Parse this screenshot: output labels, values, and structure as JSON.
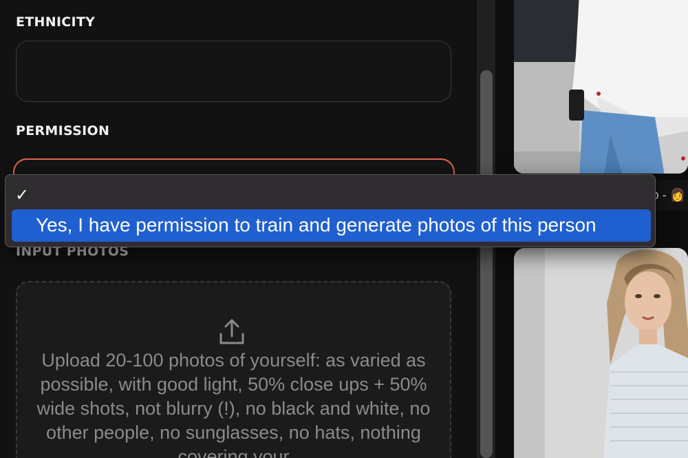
{
  "form": {
    "ethnicity_label": "ETHNICITY",
    "ethnicity_value": "",
    "permission_label": "PERMISSION",
    "input_photos_label": "INPUT PHOTOS",
    "upload_instructions": "Upload 20-100 photos of yourself: as varied as possible, with good light, 50% close ups + 50% wide shots, not blurry (!), no black and white, no other people, no sunglasses, no hats, nothing covering your"
  },
  "dropdown": {
    "options": [
      {
        "label": "",
        "checked": true
      },
      {
        "label": "Yes, I have permission to train and generate photos of this person",
        "highlighted": true
      }
    ],
    "checkmark": "✓"
  },
  "gallery": {
    "photos": [
      {
        "name": "photo-woman-white-sweater-jeans",
        "caption": "o - 👩"
      },
      {
        "name": "photo-woman-knit-sweater-portrait",
        "caption": ""
      }
    ]
  },
  "colors": {
    "accent_border": "#e06a52",
    "selection_blue": "#1f5fd0",
    "panel_bg": "#121212"
  },
  "icons": [
    "upload-icon",
    "checkmark-icon"
  ]
}
